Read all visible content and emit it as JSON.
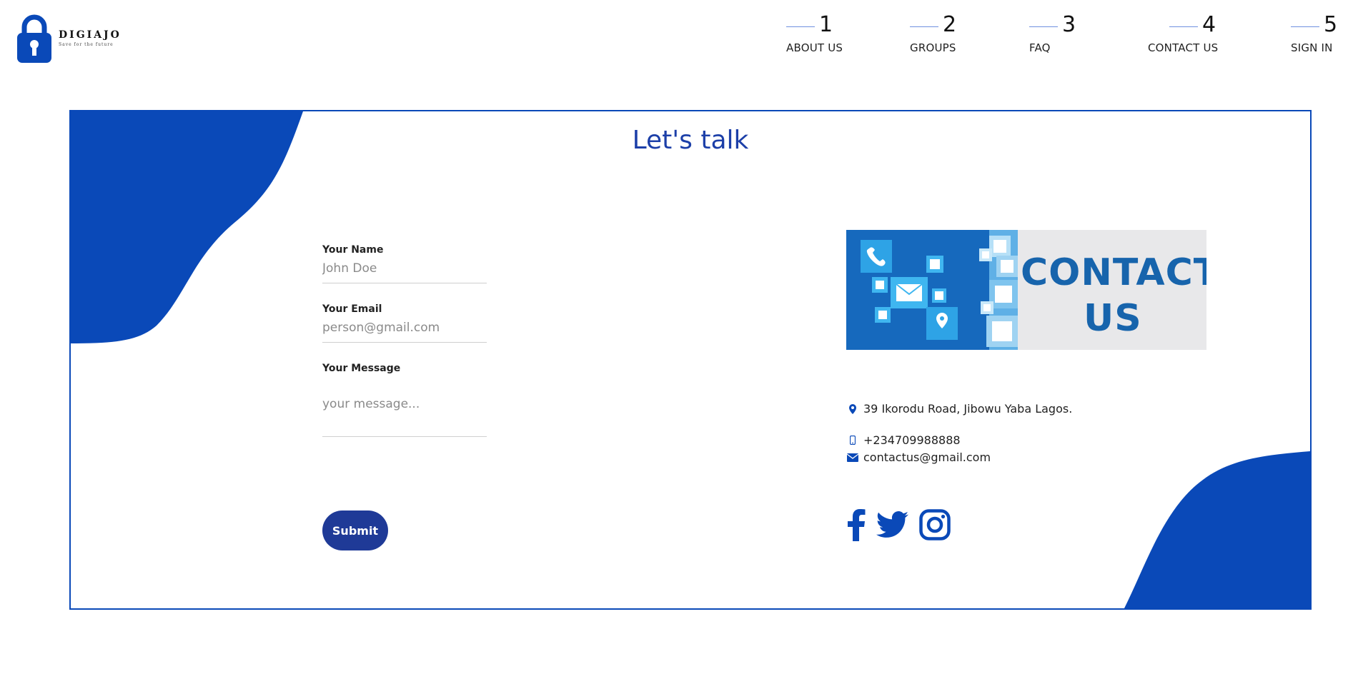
{
  "brand": {
    "name": "DIGIAJO",
    "tagline": "Save for the future",
    "accent_color": "#0a49b8"
  },
  "nav": {
    "items": [
      {
        "number": "1",
        "label": "ABOUT US"
      },
      {
        "number": "2",
        "label": "GROUPS"
      },
      {
        "number": "3",
        "label": "FAQ"
      },
      {
        "number": "4",
        "label": "CONTACT US"
      },
      {
        "number": "5",
        "label": "SIGN IN"
      }
    ]
  },
  "contact": {
    "title": "Let's talk",
    "form": {
      "name_label": "Your Name",
      "name_placeholder": "John Doe",
      "email_label": "Your Email",
      "email_placeholder": "person@gmail.com",
      "message_label": "Your Message",
      "message_placeholder": "your message...",
      "submit_label": "Submit"
    },
    "banner": {
      "line1": "CONTACT",
      "line2": "US"
    },
    "address": "39 Ikorodu Road, Jibowu Yaba Lagos.",
    "phone": "+234709988888",
    "email": "contactus@gmail.com",
    "social": [
      "facebook-icon",
      "twitter-icon",
      "instagram-icon"
    ]
  }
}
